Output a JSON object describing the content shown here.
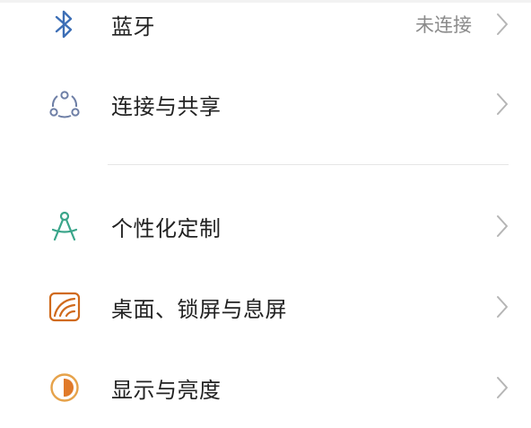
{
  "settings": {
    "items": [
      {
        "label": "蓝牙",
        "status": "未连接",
        "icon": "bluetooth-icon"
      },
      {
        "label": "连接与共享",
        "icon": "connection-sharing-icon"
      },
      {
        "label": "个性化定制",
        "icon": "compass-icon"
      },
      {
        "label": "桌面、锁屏与息屏",
        "icon": "wallpaper-icon"
      },
      {
        "label": "显示与亮度",
        "icon": "brightness-icon"
      }
    ]
  },
  "colors": {
    "bluetooth": "#3d6fb6",
    "connection": "#6e7fa6",
    "personalize": "#3aa58a",
    "wallpaper": "#d06a1c",
    "brightness": "#e6a24a",
    "chevron": "#b5b5b5",
    "label": "#222222",
    "status": "#8a8a8a"
  }
}
